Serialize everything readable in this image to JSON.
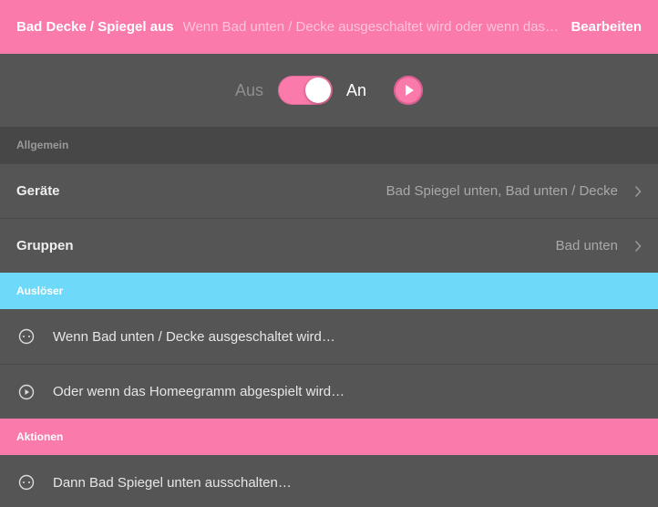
{
  "header": {
    "title": "Bad Decke / Spiegel aus",
    "description": "Wenn Bad unten / Decke ausgeschaltet wird oder wenn das Homeegramm abgespielt wird, dann Bad Spiegel unten ausschalten",
    "edit_label": "Bearbeiten"
  },
  "toggle": {
    "off_label": "Aus",
    "on_label": "An",
    "state": "on",
    "accent": "#f97aab"
  },
  "sections": {
    "general": "Allgemein",
    "triggers": "Auslöser",
    "actions": "Aktionen"
  },
  "general_rows": [
    {
      "label": "Geräte",
      "value": "Bad Spiegel unten, Bad unten / Decke"
    },
    {
      "label": "Gruppen",
      "value": "Bad unten"
    }
  ],
  "triggers": [
    {
      "icon": "dots-circle-icon",
      "text": "Wenn Bad unten / Decke ausgeschaltet wird…"
    },
    {
      "icon": "play-circle-icon",
      "text": "Oder wenn das Homeegramm abgespielt wird…"
    }
  ],
  "actions": [
    {
      "icon": "dots-circle-icon",
      "text": "Dann Bad Spiegel unten ausschalten…"
    }
  ],
  "colors": {
    "pink": "#f97aab",
    "cyan": "#6ed9f8",
    "background": "#555555"
  }
}
